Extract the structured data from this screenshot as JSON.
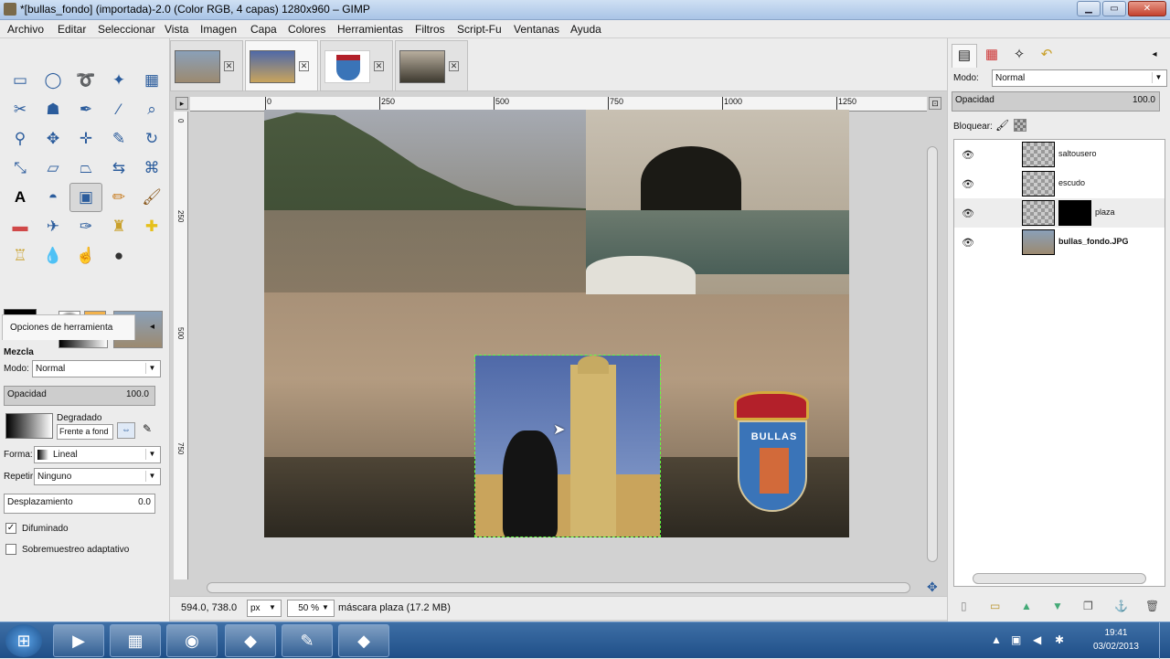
{
  "window": {
    "title": "*[bullas_fondo] (importada)-2.0 (Color RGB, 4 capas) 1280x960 – GIMP"
  },
  "menu": [
    "Archivo",
    "Editar",
    "Seleccionar",
    "Vista",
    "Imagen",
    "Capa",
    "Colores",
    "Herramientas",
    "Filtros",
    "Script-Fu",
    "Ventanas",
    "Ayuda"
  ],
  "tool_options": {
    "tab_label": "Opciones de herramienta",
    "title": "Mezcla",
    "mode_label": "Modo:",
    "mode_value": "Normal",
    "opacity_label": "Opacidad",
    "opacity_value": "100.0",
    "gradient_label": "Degradado",
    "gradient_direction": "Frente a fond",
    "shape_label": "Forma:",
    "shape_value": "Lineal",
    "repeat_label": "Repetir:",
    "repeat_value": "Ninguno",
    "offset_label": "Desplazamiento",
    "offset_value": "0.0",
    "dither_label": "Difuminado",
    "dither_checked": true,
    "supersample_label": "Sobremuestreo adaptativo",
    "supersample_checked": false
  },
  "ruler": {
    "h_labels": [
      "0",
      "250",
      "500",
      "750",
      "1000",
      "1250"
    ],
    "v_labels": [
      "0",
      "250",
      "500",
      "750"
    ]
  },
  "status": {
    "coords": "594.0, 738.0",
    "unit": "px",
    "zoom": "50 %",
    "message": "máscara plaza (17.2 MB)"
  },
  "layers_panel": {
    "mode_label": "Modo:",
    "mode_value": "Normal",
    "opacity_label": "Opacidad",
    "opacity_value": "100.0",
    "lock_label": "Bloquear:",
    "layers": [
      {
        "name": "saltousero"
      },
      {
        "name": "escudo"
      },
      {
        "name": "plaza"
      },
      {
        "name": "bullas_fondo.JPG"
      }
    ]
  },
  "image_content": {
    "shield_text": "BULLAS"
  },
  "taskbar": {
    "time": "19:41",
    "date": "03/02/2013"
  }
}
